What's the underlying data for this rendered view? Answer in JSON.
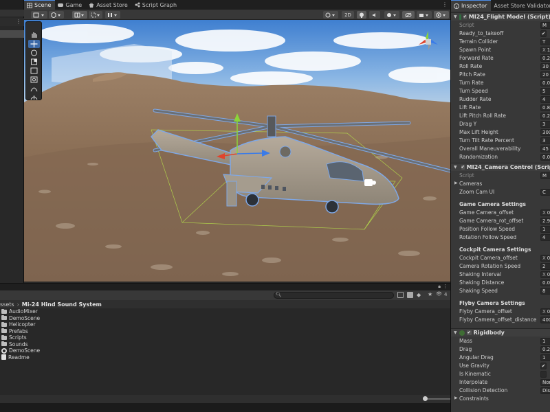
{
  "scene_tabs": [
    {
      "label": "Scene",
      "icon": "grid-icon",
      "active": true
    },
    {
      "label": "Game",
      "icon": "gamepad-icon",
      "active": false
    },
    {
      "label": "Asset Store",
      "icon": "store-icon",
      "active": false
    },
    {
      "label": "Script Graph",
      "icon": "graph-icon",
      "active": false
    }
  ],
  "scene_toolbar": {
    "mode_2d": "2D"
  },
  "project": {
    "breadcrumb": [
      "ssets",
      "Mi-24 Hind Sound System"
    ],
    "search_placeholder": "",
    "hidden_count": "4",
    "items": [
      {
        "name": "AudioMixer",
        "type": "folder"
      },
      {
        "name": "DemoScene",
        "type": "folder"
      },
      {
        "name": "Helicopter",
        "type": "folder"
      },
      {
        "name": "Prefabs",
        "type": "folder"
      },
      {
        "name": "Scripts",
        "type": "folder"
      },
      {
        "name": "Sounds",
        "type": "folder"
      },
      {
        "name": "DemoScene",
        "type": "scene"
      },
      {
        "name": "Readme",
        "type": "file"
      }
    ]
  },
  "inspector": {
    "tabs": [
      "Inspector",
      "Asset Store Validator"
    ],
    "flight_model": {
      "title": "MI24_Flight Model (Script)",
      "script_label": "Script",
      "script_value": "M",
      "props": [
        {
          "label": "Ready_to_takeoff",
          "value": "✔",
          "kind": "check"
        },
        {
          "label": "Terrain Collider",
          "value": "T",
          "kind": "object"
        },
        {
          "label": "Spawn Point",
          "value": "1",
          "kind": "xyz"
        },
        {
          "label": "Forward Rate",
          "value": "0.2",
          "kind": "num"
        },
        {
          "label": "Roll Rate",
          "value": "30",
          "kind": "num"
        },
        {
          "label": "Pitch Rate",
          "value": "20",
          "kind": "num"
        },
        {
          "label": "Turn Rate",
          "value": "0.0",
          "kind": "num"
        },
        {
          "label": "Turn Speed",
          "value": "5",
          "kind": "num"
        },
        {
          "label": "Rudder Rate",
          "value": "4",
          "kind": "num"
        },
        {
          "label": "Lift Rate",
          "value": "0.8",
          "kind": "num"
        },
        {
          "label": "Lift Pitch Roll Rate",
          "value": "0.2",
          "kind": "num"
        },
        {
          "label": "Drag Y",
          "value": "3",
          "kind": "num"
        },
        {
          "label": "Max Lift Height",
          "value": "300",
          "kind": "num"
        },
        {
          "label": "Turn Tilt Rate Percent",
          "value": "3",
          "kind": "num"
        },
        {
          "label": "Overall Maneuverability",
          "value": "45",
          "kind": "num"
        },
        {
          "label": "Randomization",
          "value": "0.0",
          "kind": "num"
        }
      ]
    },
    "camera_control": {
      "title": "MI24_Camera Control (Script)",
      "script_label": "Script",
      "script_value": "M",
      "cameras_label": "Cameras",
      "zoom_label": "Zoom Cam UI",
      "zoom_value": "C",
      "game_header": "Game Camera Settings",
      "game_props": [
        {
          "label": "Game Camera_offset",
          "value": "0",
          "kind": "xyz"
        },
        {
          "label": "Game Camera_rot_offset",
          "value": "2.9",
          "kind": "num"
        },
        {
          "label": "Position Follow Speed",
          "value": "1",
          "kind": "num"
        },
        {
          "label": "Rotation Follow Speed",
          "value": "4",
          "kind": "num"
        }
      ],
      "cockpit_header": "Cockpit Camera Settings",
      "cockpit_props": [
        {
          "label": "Cockpit Camera_offset",
          "value": "0",
          "kind": "xyz"
        },
        {
          "label": "Camera Rotation Speed",
          "value": "2",
          "kind": "num"
        },
        {
          "label": "Shaking Interval",
          "value": "0",
          "kind": "xyz"
        },
        {
          "label": "Shaking Distance",
          "value": "0.0",
          "kind": "num"
        },
        {
          "label": "Shaking Speed",
          "value": "8",
          "kind": "num"
        }
      ],
      "flyby_header": "Flyby Camera Settings",
      "flyby_props": [
        {
          "label": "Flyby Camera_offset",
          "value": "0",
          "kind": "xyz"
        },
        {
          "label": "Flyby Camera_offset_distance",
          "value": "400",
          "kind": "num"
        }
      ]
    },
    "rigidbody": {
      "title": "Rigidbody",
      "props": [
        {
          "label": "Mass",
          "value": "1",
          "kind": "num"
        },
        {
          "label": "Drag",
          "value": "0.2",
          "kind": "num"
        },
        {
          "label": "Angular Drag",
          "value": "1",
          "kind": "num"
        },
        {
          "label": "Use Gravity",
          "value": "✔",
          "kind": "check"
        },
        {
          "label": "Is Kinematic",
          "value": "",
          "kind": "check"
        },
        {
          "label": "Interpolate",
          "value": "Nor",
          "kind": "enum"
        },
        {
          "label": "Collision Detection",
          "value": "Dis",
          "kind": "enum"
        }
      ],
      "constraints_label": "Constraints"
    }
  },
  "colors": {
    "accent": "#4d8ee8",
    "selection_outline": "#7fa8e6",
    "gizmo_x": "#e0442d",
    "gizmo_y": "#8bd43a",
    "gizmo_z": "#3b7be8"
  }
}
